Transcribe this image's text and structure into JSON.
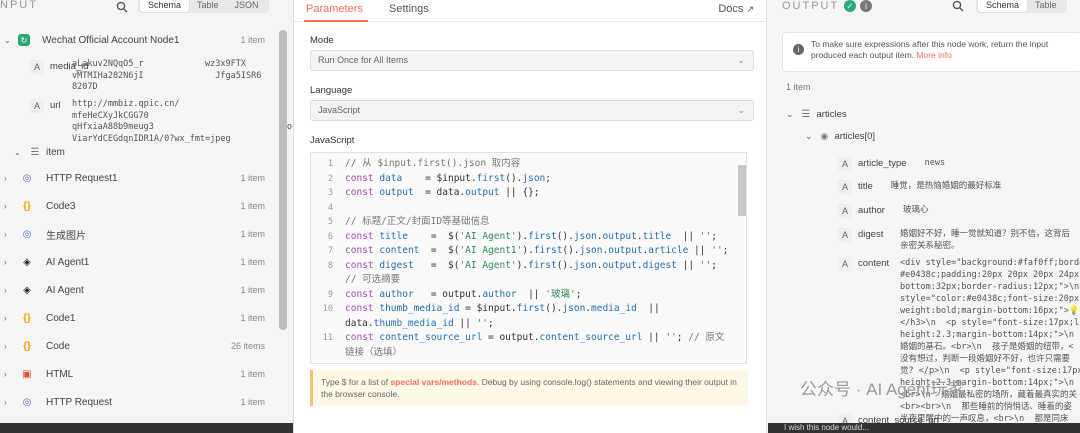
{
  "left": {
    "title": "NPUT",
    "search_icon": "search-icon",
    "tabs": [
      "Schema",
      "Table",
      "JSON"
    ],
    "active_tab": "Schema",
    "node_name": "Wechat Official Account Node1",
    "node_count": "1 item",
    "field_media_id": {
      "type": "A",
      "name": "media_id",
      "value": "aLakuv2NQqO5_r            wz3x9FTX\nvMTMIHa282N6jI              Jfga5ISR6\n8207D"
    },
    "field_url": {
      "type": "A",
      "name": "url",
      "value": "http://mmbiz.qpic.cn/                       5wL\nmfeHeCXyJkCGG70                                PH\nqHfxiaA88b9meug3                         pocucp\nViarYdCEGdqnIDR1A/0?wx_fmt=jpeg"
    },
    "item_label": "item",
    "nodes": [
      {
        "label": "HTTP Request1",
        "count": "1 item",
        "icon": "globe-icon"
      },
      {
        "label": "Code3",
        "count": "1 item",
        "icon": "code-icon"
      },
      {
        "label": "生成图片",
        "count": "1 item",
        "icon": "globe-icon"
      },
      {
        "label": "AI Agent1",
        "count": "1 item",
        "icon": "robot-icon"
      },
      {
        "label": "AI Agent",
        "count": "1 item",
        "icon": "robot-icon"
      },
      {
        "label": "Code1",
        "count": "1 item",
        "icon": "code-icon"
      },
      {
        "label": "Code",
        "count": "26 items",
        "icon": "code-icon"
      },
      {
        "label": "HTML",
        "count": "1 item",
        "icon": "html-icon"
      },
      {
        "label": "HTTP Request",
        "count": "1 item",
        "icon": "globe-icon"
      }
    ]
  },
  "center": {
    "tabs": [
      "Parameters",
      "Settings"
    ],
    "docs": "Docs",
    "mode_label": "Mode",
    "mode_value": "Run Once for All Items",
    "language_label": "Language",
    "language_value": "JavaScript",
    "editor_label": "JavaScript",
    "code_lines": [
      {
        "n": "1",
        "html": "<span class=\"cm\">// 从 $input.first().json 取内容</span>"
      },
      {
        "n": "2",
        "html": "<span class=\"kw\">const</span> <span class=\"id\">data</span>    = $input.<span class=\"id\">first</span>().<span class=\"id\">json</span>;"
      },
      {
        "n": "3",
        "html": "<span class=\"kw\">const</span> <span class=\"id\">output</span>  = data.<span class=\"id\">output</span> || {};"
      },
      {
        "n": "4",
        "html": ""
      },
      {
        "n": "5",
        "html": "<span class=\"cm\">// 标题/正文/封面ID等基础信息</span>"
      },
      {
        "n": "6",
        "html": "<span class=\"kw\">const</span> <span class=\"id\">title</span>    =  $(<span class=\"str\">'AI Agent'</span>).<span class=\"id\">first</span>().<span class=\"id\">json</span>.<span class=\"id\">output</span>.<span class=\"id\">title</span>  || <span class=\"str\">''</span>;"
      },
      {
        "n": "7",
        "html": "<span class=\"kw\">const</span> <span class=\"id\">content</span>  =  $(<span class=\"str\">'AI Agent1'</span>).<span class=\"id\">first</span>().<span class=\"id\">json</span>.<span class=\"id\">output</span>.<span class=\"id\">article</span> || <span class=\"str\">''</span>;"
      },
      {
        "n": "8",
        "html": "<span class=\"kw\">const</span> <span class=\"id\">digest</span>   =  $(<span class=\"str\">'AI Agent'</span>).<span class=\"id\">first</span>().<span class=\"id\">json</span>.<span class=\"id\">output</span>.<span class=\"id\">digest</span> || <span class=\"str\">''</span>;"
      },
      {
        "n": "",
        "html": "<span class=\"cm\">// 可选摘要</span>"
      },
      {
        "n": "9",
        "html": "<span class=\"kw\">const</span> <span class=\"id\">author</span>   = output.<span class=\"id\">author</span>  || <span class=\"str\">'玻璃'</span>;"
      },
      {
        "n": "10",
        "html": "<span class=\"kw\">const</span> <span class=\"id\">thumb_media_id</span> = $input.<span class=\"id\">first</span>().<span class=\"id\">json</span>.<span class=\"id\">media_id</span>  ||"
      },
      {
        "n": "",
        "html": "data.<span class=\"id\">thumb_media_id</span> || <span class=\"str\">''</span>;"
      },
      {
        "n": "11",
        "html": "<span class=\"kw\">const</span> <span class=\"id\">content_source_url</span> = output.<span class=\"id\">content_source_url</span> || <span class=\"str\">''</span>; <span class=\"cm\">// 原文</span>"
      },
      {
        "n": "",
        "html": "<span class=\"cm\">链接（选填）</span>"
      }
    ],
    "hint_pre": "Type $ for a list of ",
    "hint_em": "special vars/methods",
    "hint_post": ". Debug by using console.log() statements and viewing their output in the browser console."
  },
  "right": {
    "title": "OUTPUT",
    "tabs": [
      "Schema",
      "Table"
    ],
    "active_tab": "Schema",
    "info_text": "To make sure expressions after this node work, return the input produced each output item.",
    "info_link": "More info",
    "count": "1 item",
    "articles_label": "articles",
    "articles0_label": "articles[0]",
    "fields": [
      {
        "type": "A",
        "name": "article_type",
        "value": "news"
      },
      {
        "type": "A",
        "name": "title",
        "value": "睡觉，是热恼婚姻的最好标准"
      },
      {
        "type": "A",
        "name": "author",
        "value": "玻璃心"
      },
      {
        "type": "A",
        "name": "digest",
        "value": "婚姻好不好，睡一觉就知道？别不信，这背后\n亲密关系秘密。"
      },
      {
        "type": "A",
        "name": "content",
        "value": "<div style=\"background:#faf0ff;border-le\n#e0438c;padding:20px 20px 20px 24px;m\nbottom:32px;border-radius:12px;\">\\n  <\nstyle=\"color:#e0438c;font-size:20px;font\nweight:bold;margin-bottom:16px;\">💡 睡\n</h3>\\n  <p style=\"font-size:17px;line-\nheight:2.3;margin-bottom:14px;\">\\n  都说\n婚姻的基石。<br>\\n  孩子是婚姻的纽带，<\n没有想过，判断一段婚姻好不好，也许只需要\n觉? </p>\\n  <p style=\"font-size:17px;lin\nheight:2.3;margin-bottom:14px;\">\\n  这不\n<br>\\n  婚姻最私密的场所，藏着最真实的关\n<br><br>\\n  那些睡前的悄悄话、睡着的姿\n半夜里醒中的一声叹息，<br>\\n  都是同床\n的答案。<br>\\n  \\n  </p>\\n  ..."
      },
      {
        "type": "A",
        "name": "content_source_url",
        "value": ""
      }
    ],
    "footer_hint": "I wish this node would..."
  },
  "watermark": "公众号 · AI Agent玩家",
  "colors": {
    "accent": "#ff6d5a",
    "success": "#2aa876",
    "panel": "#f5f5f5"
  }
}
